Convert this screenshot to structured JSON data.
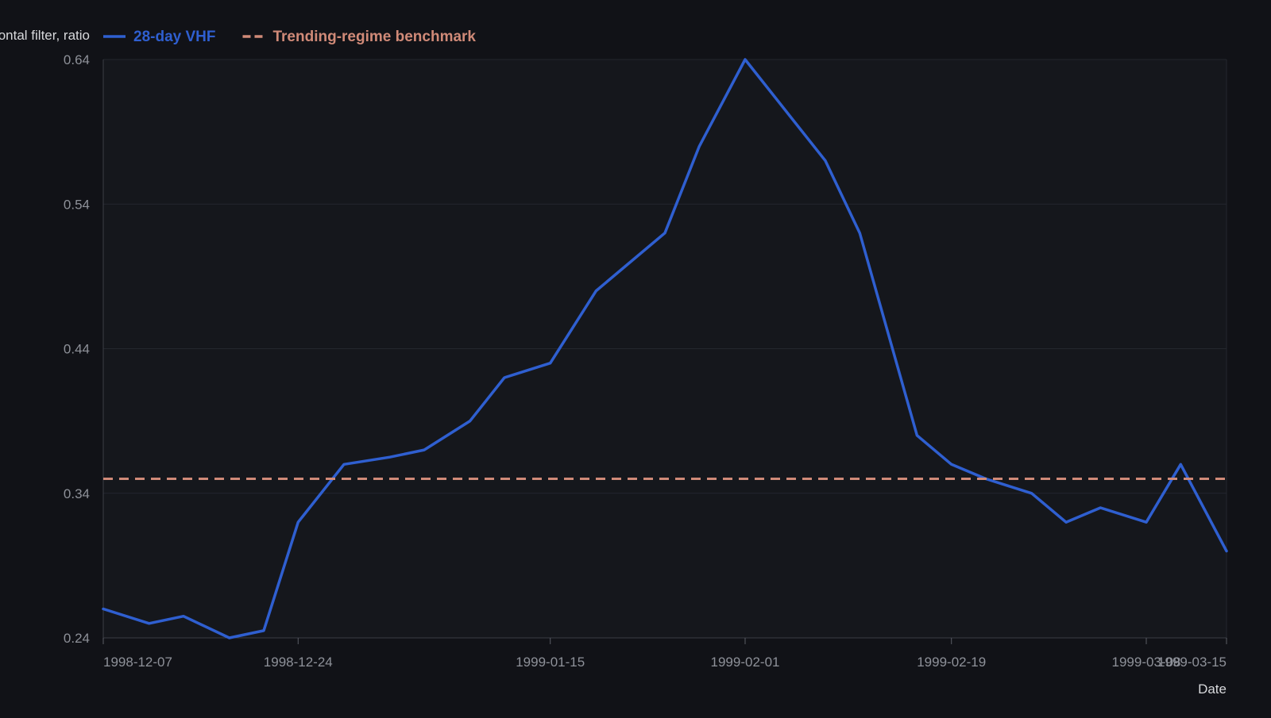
{
  "colors": {
    "background": "#111217",
    "plot_background": "#15171c",
    "grid": "#24272e",
    "axis_text": "#8e9199",
    "label_text": "#d8d9dc",
    "vhf_line": "#2f5fd0",
    "benchmark_line": "#d08a78"
  },
  "chart_data": {
    "type": "line",
    "title": "",
    "xlabel": "Date",
    "ylabel": "Vertical horizontal filter, ratio",
    "ylim": [
      0.24,
      0.64
    ],
    "yticks": [
      0.24,
      0.34,
      0.44,
      0.54,
      0.64
    ],
    "ytick_labels": [
      "0.24",
      "0.34",
      "0.44",
      "0.54",
      "0.64"
    ],
    "xlim": [
      "1998-12-07",
      "1999-03-15"
    ],
    "xticks": [
      "1998-12-07",
      "1998-12-24",
      "1999-01-15",
      "1999-02-01",
      "1999-02-19",
      "1999-03-08",
      "1999-03-15"
    ],
    "grid": true,
    "legend_position": "top-left",
    "series": [
      {
        "name": "28-day VHF",
        "style": "solid",
        "color": "#2f5fd0",
        "x": [
          "1998-12-07",
          "1998-12-11",
          "1998-12-14",
          "1998-12-18",
          "1998-12-21",
          "1998-12-24",
          "1998-12-28",
          "1999-01-01",
          "1999-01-04",
          "1999-01-08",
          "1999-01-11",
          "1999-01-15",
          "1999-01-19",
          "1999-01-22",
          "1999-01-25",
          "1999-01-28",
          "1999-02-01",
          "1999-02-05",
          "1999-02-08",
          "1999-02-11",
          "1999-02-16",
          "1999-02-19",
          "1999-02-22",
          "1999-02-26",
          "1999-03-01",
          "1999-03-04",
          "1999-03-08",
          "1999-03-11",
          "1999-03-15"
        ],
        "y": [
          0.26,
          0.25,
          0.255,
          0.24,
          0.245,
          0.32,
          0.36,
          0.365,
          0.37,
          0.39,
          0.42,
          0.43,
          0.48,
          0.5,
          0.52,
          0.58,
          0.64,
          0.6,
          0.57,
          0.52,
          0.38,
          0.36,
          0.35,
          0.34,
          0.32,
          0.33,
          0.32,
          0.36,
          0.3
        ]
      },
      {
        "name": "Trending-regime benchmark",
        "style": "dashed",
        "color": "#d08a78",
        "x": [
          "1998-12-07",
          "1999-03-15"
        ],
        "y": [
          0.35,
          0.35
        ]
      }
    ]
  }
}
